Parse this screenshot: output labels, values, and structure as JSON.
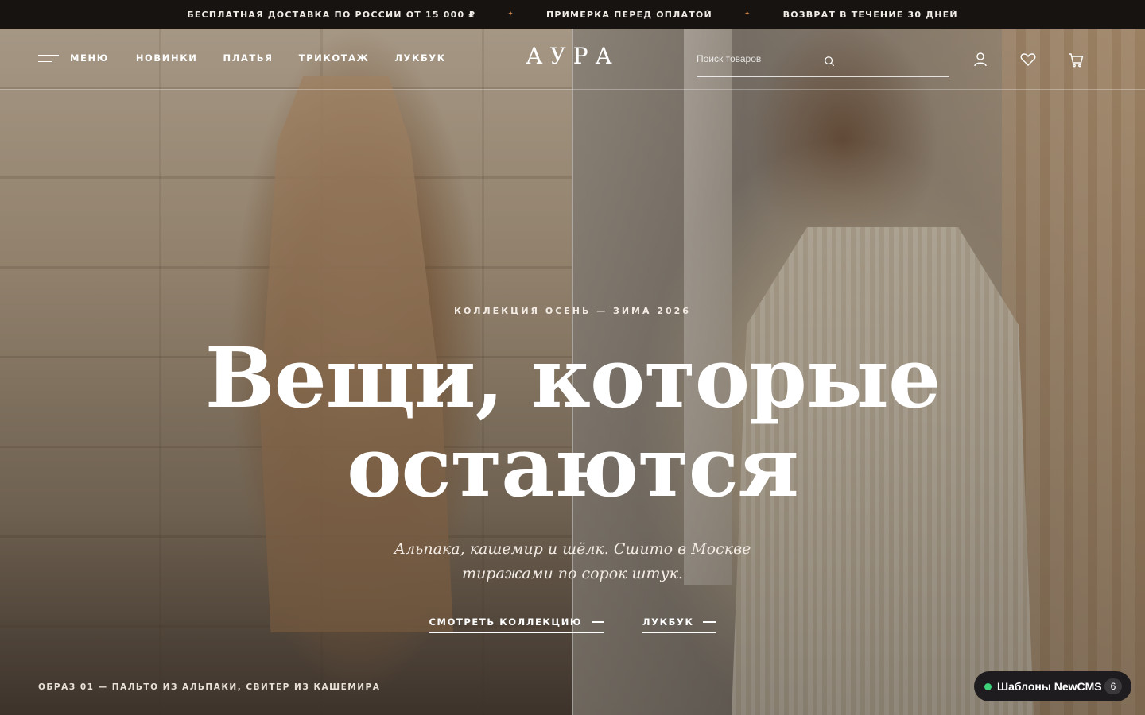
{
  "announcement": {
    "items": [
      "БЕСПЛАТНАЯ ДОСТАВКА ПО РОССИИ ОТ 15 000 ₽",
      "ПРИМЕРКА ПЕРЕД ОПЛАТОЙ",
      "ВОЗВРАТ В ТЕЧЕНИЕ 30 ДНЕЙ"
    ],
    "separator": "✦"
  },
  "header": {
    "menu_label": "МЕНЮ",
    "nav": [
      "НОВИНКИ",
      "ПЛАТЬЯ",
      "ТРИКОТАЖ",
      "ЛУКБУК"
    ],
    "logo": "АУРА",
    "search_placeholder": "Поиск товаров",
    "icons": [
      "search-icon",
      "user-icon",
      "heart-icon",
      "cart-icon"
    ]
  },
  "hero": {
    "eyebrow": "КОЛЛЕКЦИЯ ОСЕНЬ — ЗИМА 2026",
    "headline_line1": "Вещи, которые",
    "headline_line2": "остаются",
    "subtitle_line1": "Альпака, кашемир и шёлк. Сшито в Москве",
    "subtitle_line2": "тиражами по сорок штук.",
    "cta_primary": "СМОТРЕТЬ КОЛЛЕКЦИЮ",
    "cta_secondary": "ЛУКБУК",
    "caption": "ОБРАЗ 01 — ПАЛЬТО ИЗ АЛЬПАКИ, СВИТЕР ИЗ КАШЕМИРА"
  },
  "badge": {
    "label": "Шаблоны NewCMS",
    "count": "6",
    "status_color": "#3ed27a"
  },
  "colors": {
    "topbar_bg": "#171311",
    "accent": "#c8824a"
  }
}
